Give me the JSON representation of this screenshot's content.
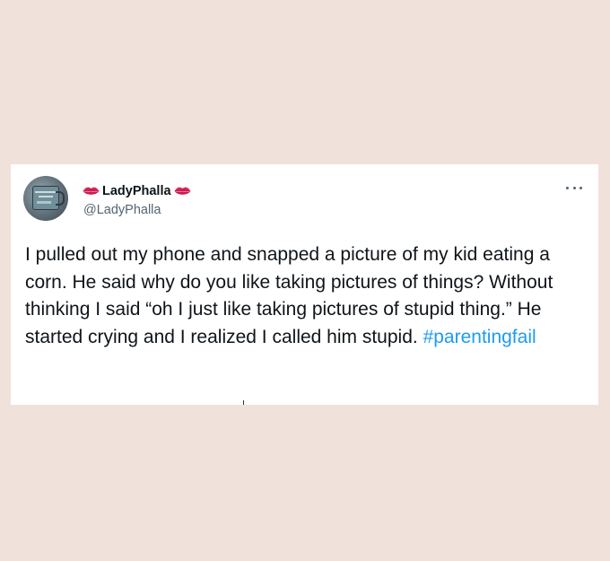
{
  "tweet": {
    "display_name": "LadyPhalla",
    "handle": "@LadyPhalla",
    "text": "I pulled out my phone and snapped a picture of my kid eating a corn. He said why do you like taking pictures of things? Without thinking I said “oh I just like taking pictures of stupid thing.” He started crying and I realized I called him stupid.",
    "hashtag": "#parentingfail",
    "name_emoji": "lips-icon",
    "more_icon": "more-options-icon"
  },
  "colors": {
    "background": "#f0e2da",
    "card": "#ffffff",
    "text": "#0f1419",
    "secondary_text": "#536471",
    "hashtag": "#1d9bf0",
    "lips": "#e0245e"
  }
}
